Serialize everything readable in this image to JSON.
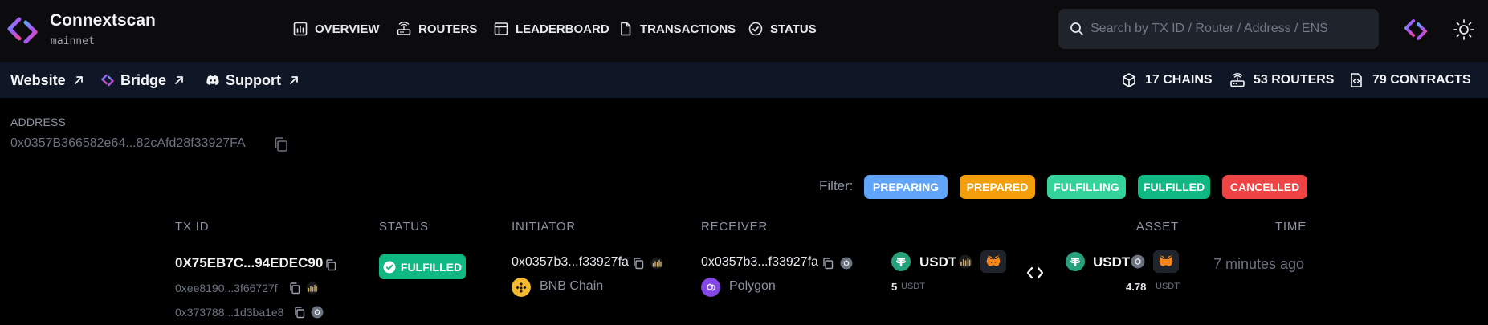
{
  "brand": {
    "title": "Connextscan",
    "network": "mainnet"
  },
  "nav": [
    {
      "label": "OVERVIEW",
      "icon": "dashboard-icon"
    },
    {
      "label": "ROUTERS",
      "icon": "router-icon"
    },
    {
      "label": "LEADERBOARD",
      "icon": "table-icon"
    },
    {
      "label": "TRANSACTIONS",
      "icon": "file-icon"
    },
    {
      "label": "STATUS",
      "icon": "status-icon"
    }
  ],
  "search": {
    "placeholder": "Search by TX ID / Router / Address / ENS",
    "value": ""
  },
  "sublinks": [
    {
      "label": "Website",
      "icon": "external-link-icon"
    },
    {
      "label": "Bridge",
      "icon": "connext-icon"
    },
    {
      "label": "Support",
      "icon": "discord-icon"
    }
  ],
  "stats": [
    {
      "label": "17 CHAINS",
      "icon": "cube-icon"
    },
    {
      "label": "53 ROUTERS",
      "icon": "router-icon"
    },
    {
      "label": "79 CONTRACTS",
      "icon": "contract-icon"
    }
  ],
  "address": {
    "label": "ADDRESS",
    "value": "0x0357B366582e64...82cAfd28f33927FA"
  },
  "filter": {
    "label": "Filter:",
    "options": [
      {
        "label": "PREPARING",
        "color": "#60a5fa"
      },
      {
        "label": "PREPARED",
        "color": "#f59e0b"
      },
      {
        "label": "FULFILLING",
        "color": "#34d399"
      },
      {
        "label": "FULFILLED",
        "color": "#10b981"
      },
      {
        "label": "CANCELLED",
        "color": "#ef4444"
      }
    ]
  },
  "table": {
    "headers": {
      "txid": "TX ID",
      "status": "STATUS",
      "initiator": "INITIATOR",
      "receiver": "RECEIVER",
      "asset": "ASSET",
      "time": "TIME"
    },
    "row": {
      "txid": "0X75EB7C...94EDEC90",
      "send_tx": "0xee8190...3f66727f",
      "receive_tx": "0x373788...1d3ba1e8",
      "status": "FULFILLED",
      "initiator": {
        "address": "0x0357b3...f33927fa",
        "chain": "BNB Chain"
      },
      "receiver": {
        "address": "0x0357b3...f33927fa",
        "chain": "Polygon"
      },
      "send_asset": {
        "symbol": "USDT",
        "amount": "5",
        "unit": "USDT"
      },
      "receive_asset": {
        "symbol": "USDT",
        "amount": "4.78",
        "unit": "USDT"
      },
      "time": "7 minutes ago"
    }
  },
  "colors": {
    "accent": "#10b981",
    "bnb": "#f3ba2f",
    "polygon": "#8247e5",
    "tether": "#26a17b"
  }
}
